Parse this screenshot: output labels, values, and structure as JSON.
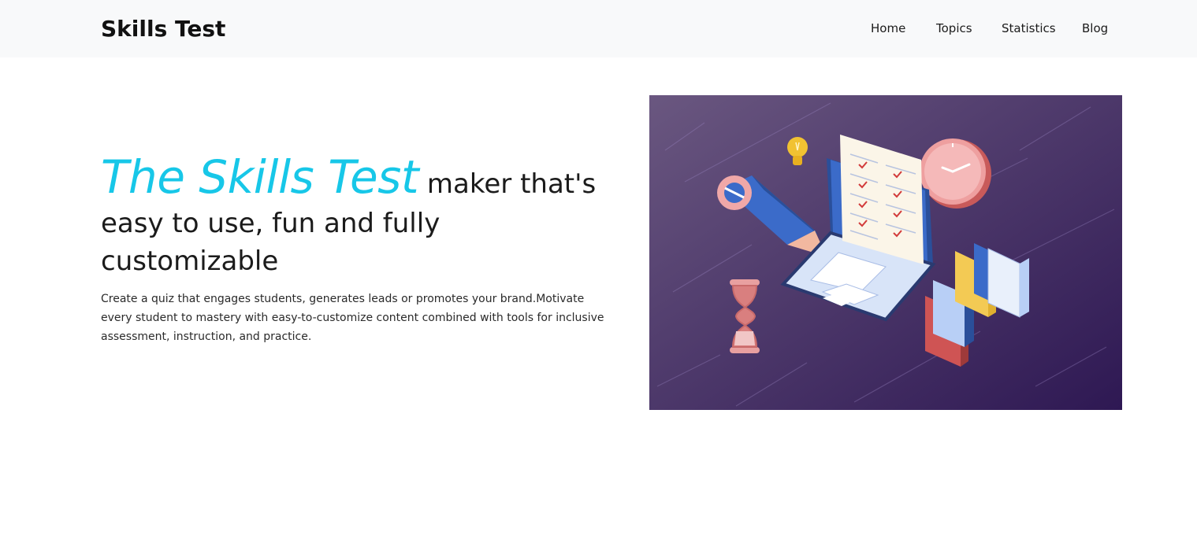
{
  "navbar": {
    "brand": "Skills Test",
    "links": [
      {
        "label": "Home"
      },
      {
        "label": "Topics"
      },
      {
        "label": "Statistics"
      },
      {
        "label": "Blog"
      }
    ]
  },
  "hero": {
    "heading_accent": "The Skills Test",
    "heading_rest": " maker that's easy to use, fun and fully customizable",
    "description": "Create a quiz that engages students, generates leads or promotes your brand.Motivate every student to mastery with easy-to-customize content combined with tools for inclusive assessment, instruction, and practice.",
    "image": {
      "description": "isometric illustration of a laptop with a quiz checklist, pencil, lightbulb, clock, hourglass and books",
      "background_colors": [
        "#6a5780",
        "#2e1853"
      ],
      "accent_color": "#17c7e8"
    }
  },
  "colors": {
    "navbar_bg": "#f8f9fa",
    "accent": "#17c7e8",
    "text": "#212529"
  }
}
